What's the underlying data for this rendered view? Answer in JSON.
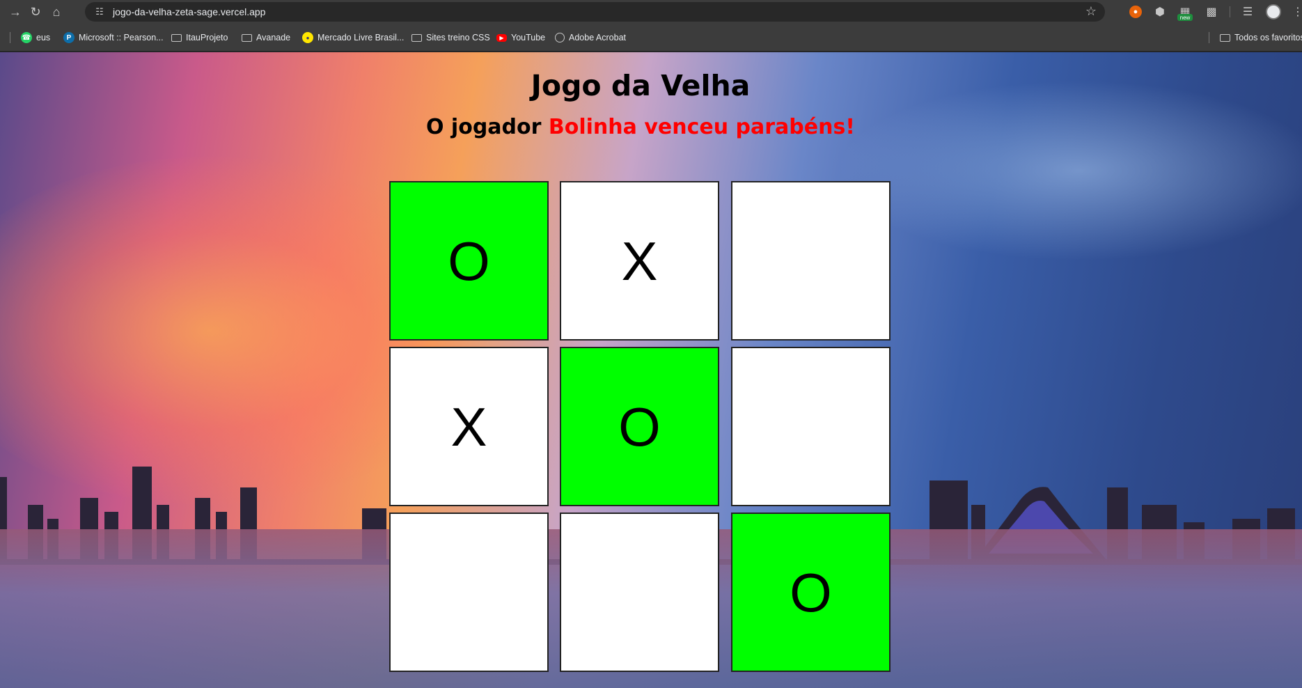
{
  "browser": {
    "url": "jogo-da-velha-zeta-sage.vercel.app",
    "extensions": [
      {
        "name": "orange-extension-icon"
      },
      {
        "name": "cube-extension-icon"
      },
      {
        "name": "new-extension-icon",
        "badge": "new"
      },
      {
        "name": "puzzle-extensions-icon"
      }
    ]
  },
  "bookmarks": {
    "items": [
      {
        "label": "eus",
        "icon": "whatsapp-icon"
      },
      {
        "label": "Microsoft :: Pearson...",
        "icon": "pearson-icon"
      },
      {
        "label": "ItauProjeto",
        "icon": "folder-icon"
      },
      {
        "label": "Avanade",
        "icon": "folder-icon"
      },
      {
        "label": "Mercado Livre Brasil...",
        "icon": "mercadolivre-icon"
      },
      {
        "label": "Sites treino CSS",
        "icon": "folder-icon"
      },
      {
        "label": "YouTube",
        "icon": "youtube-icon"
      },
      {
        "label": "Adobe Acrobat",
        "icon": "globe-icon"
      }
    ],
    "all_bookmarks": "Todos os favoritos"
  },
  "game": {
    "title": "Jogo da Velha",
    "status_prefix": "O jogador ",
    "status_winner": "Bolinha venceu parabéns!",
    "board": [
      "O",
      "X",
      "",
      "X",
      "O",
      "",
      "",
      "",
      "O"
    ],
    "winning_cells": [
      0,
      4,
      8
    ],
    "colors": {
      "win": "#00ff00",
      "cell": "#ffffff",
      "winner_text": "#ff0000"
    }
  }
}
